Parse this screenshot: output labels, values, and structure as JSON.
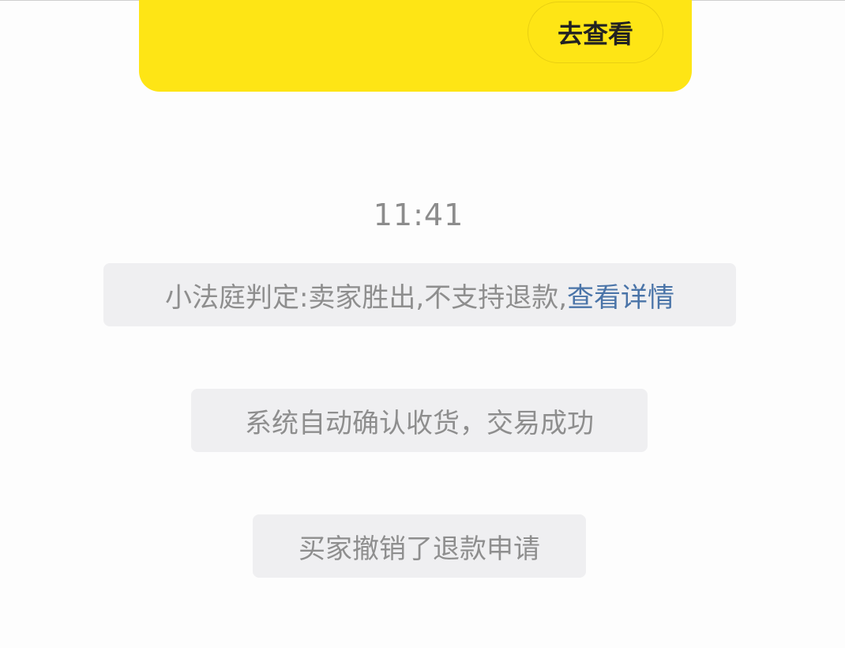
{
  "banner": {
    "view_button_label": "去查看"
  },
  "chat": {
    "timestamp": "11:41",
    "messages": [
      {
        "text": "小法庭判定:卖家胜出,不支持退款,",
        "link": "查看详情"
      },
      {
        "text": "系统自动确认收货，交易成功"
      },
      {
        "text": "买家撤销了退款申请"
      }
    ]
  },
  "colors": {
    "banner_yellow": "#fee515",
    "link_blue": "#4a74a8",
    "system_text_gray": "#8e8e8e",
    "system_bubble_bg": "#efeff1"
  }
}
